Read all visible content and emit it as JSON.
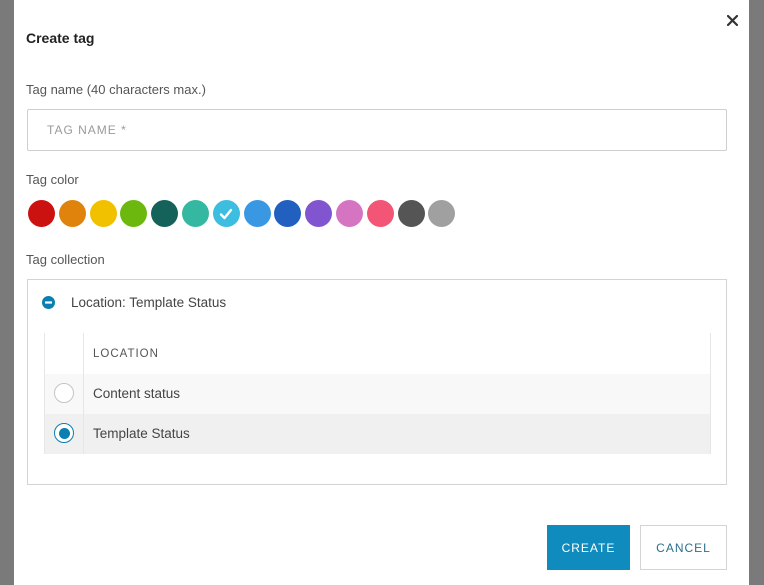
{
  "dialog": {
    "title": "Create tag",
    "close_icon": "close-icon"
  },
  "tag_name": {
    "label": "Tag name (40 characters max.)",
    "placeholder": "TAG NAME *",
    "value": ""
  },
  "tag_color": {
    "label": "Tag color",
    "selected_index": 6,
    "swatches": [
      "#cc1111",
      "#e0830c",
      "#f1c100",
      "#6cb80f",
      "#14625a",
      "#35b8a1",
      "#3dbde0",
      "#3a98e3",
      "#2160be",
      "#8155d0",
      "#d575c2",
      "#f25576",
      "#555555",
      "#a0a0a0"
    ]
  },
  "tag_collection": {
    "label": "Tag collection",
    "group_label": "Location: Template Status",
    "group_icon": "minus-circle-icon",
    "table": {
      "header": "LOCATION",
      "rows": [
        {
          "label": "Content status",
          "selected": false
        },
        {
          "label": "Template Status",
          "selected": true
        }
      ]
    }
  },
  "buttons": {
    "create": "CREATE",
    "cancel": "CANCEL"
  },
  "colors": {
    "accent": "#0f8bbd",
    "radio_selected": "#0b7fb0",
    "row_alt": "#f8f8f8",
    "row_selected": "#f0f0f0"
  }
}
